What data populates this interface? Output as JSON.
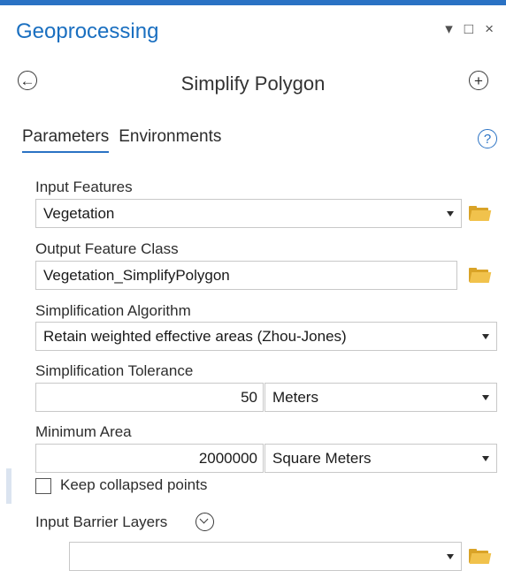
{
  "pane": {
    "title": "Geoprocessing",
    "controls": {
      "pin": "▾",
      "maximize": "□",
      "close": "×"
    }
  },
  "tool": {
    "back_icon": "←",
    "title": "Simplify Polygon",
    "add_icon": "+"
  },
  "tabs": [
    {
      "label": "Parameters",
      "active": true
    },
    {
      "label": "Environments",
      "active": false
    }
  ],
  "help_icon": "?",
  "params": {
    "input_features": {
      "label": "Input Features",
      "value": "Vegetation"
    },
    "output_feature_class": {
      "label": "Output Feature Class",
      "value": "Vegetation_SimplifyPolygon"
    },
    "algorithm": {
      "label": "Simplification Algorithm",
      "value": "Retain weighted effective areas (Zhou-Jones)"
    },
    "tolerance": {
      "label": "Simplification Tolerance",
      "value": "50",
      "unit": "Meters"
    },
    "min_area": {
      "label": "Minimum Area",
      "value": "2000000",
      "unit": "Square Meters"
    },
    "keep_collapsed": {
      "label": "Keep collapsed points",
      "checked": false
    },
    "barrier_layers": {
      "label": "Input Barrier Layers",
      "value": ""
    }
  },
  "colors": {
    "accent": "#2a72c4",
    "folder": "#f1c24c"
  }
}
